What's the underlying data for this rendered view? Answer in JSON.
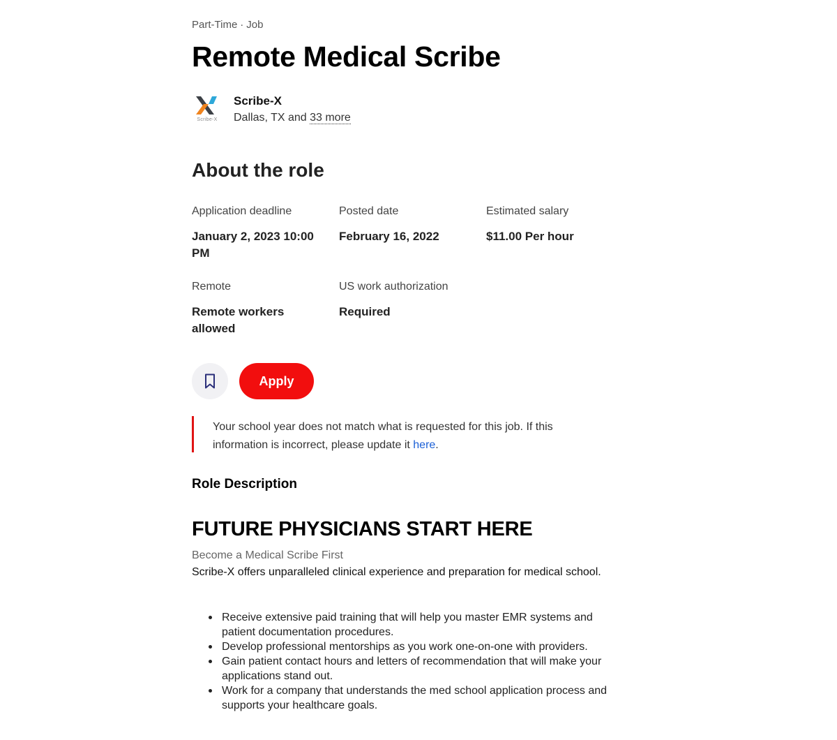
{
  "job": {
    "type": "Part-Time",
    "separator": "·",
    "category": "Job",
    "title": "Remote Medical Scribe"
  },
  "employer": {
    "name": "Scribe-X",
    "logo_caption": "Scribe-X",
    "location": "Dallas, TX and",
    "more_locations": "33 more",
    "logo_colors": [
      "#3c4045",
      "#f0841e",
      "#2ea8d9"
    ]
  },
  "about": {
    "heading": "About the role",
    "facts": [
      {
        "label": "Application deadline",
        "value": "January 2, 2023 10:00 PM"
      },
      {
        "label": "Posted date",
        "value": "February 16, 2022"
      },
      {
        "label": "Estimated salary",
        "value": "$11.00 Per hour"
      },
      {
        "label": "Remote",
        "value": "Remote workers allowed"
      },
      {
        "label": "US work authorization",
        "value": "Required"
      }
    ]
  },
  "actions": {
    "bookmark_icon": "bookmark-icon",
    "apply_label": "Apply",
    "accent_color": "#f20e0e"
  },
  "notice": {
    "text": "Your school year does not match what is requested for this job. If this information is incorrect, please update it",
    "link_text": "here",
    "trailing": "."
  },
  "description": {
    "section_title": "Role Description",
    "heading": "FUTURE PHYSICIANS START HERE",
    "subheading": "Become a Medical Scribe First",
    "intro": "Scribe-X offers unparalleled clinical experience and preparation for medical school.",
    "bullets": [
      "Receive extensive paid training that will help you master EMR systems and patient documentation procedures.",
      "Develop professional mentorships as you work one-on-one with providers.",
      "Gain patient contact hours and letters of recommendation that will make your applications stand out.",
      "Work for a company that understands the med school application process and supports your healthcare goals."
    ]
  }
}
